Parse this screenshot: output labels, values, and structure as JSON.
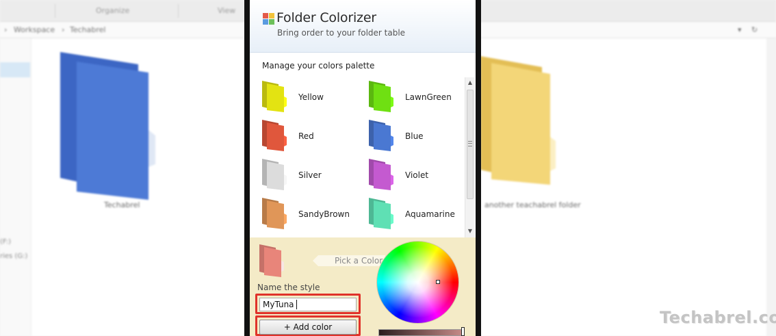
{
  "background_window": {
    "toolbar_items": [
      "Organize",
      "View"
    ],
    "breadcrumb": [
      "Workspace",
      "Techabrel"
    ],
    "drives": [
      "(F:)",
      "ries (G:)"
    ],
    "folders": [
      {
        "label": "Techabrel",
        "color": "#3f6fd0"
      },
      {
        "label": "another teachabrel folder",
        "color": "#f0cf6c"
      }
    ]
  },
  "app": {
    "title": "Folder Colorizer",
    "subtitle": "Bring order to your folder table",
    "palette_heading": "Manage your colors palette",
    "palette": [
      {
        "name": "Yellow",
        "color": "#e3e312"
      },
      {
        "name": "LawnGreen",
        "color": "#6fe012"
      },
      {
        "name": "Red",
        "color": "#e0573c"
      },
      {
        "name": "Blue",
        "color": "#4a78d2"
      },
      {
        "name": "Silver",
        "color": "#dcdcdc"
      },
      {
        "name": "Violet",
        "color": "#c45ad0"
      },
      {
        "name": "SandyBrown",
        "color": "#e09658"
      },
      {
        "name": "Aquamarine",
        "color": "#5fe0b4"
      }
    ],
    "editor": {
      "preview_color": "#e8857a",
      "pick_label": "Pick a Color",
      "name_label": "Name the style",
      "name_value": "MyTuna",
      "add_button": "+ Add color"
    },
    "highlight_color": "#e0322a"
  },
  "watermark": "Techabrel.com"
}
